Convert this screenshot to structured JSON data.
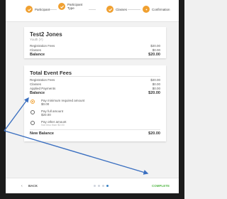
{
  "stepper": {
    "steps": [
      {
        "label": "Participant"
      },
      {
        "label": "Participant Type"
      },
      {
        "label": "Classes"
      },
      {
        "label": "Confirmation"
      }
    ]
  },
  "participant_card": {
    "name": "Test2 Jones",
    "subtitle": "Youth (Y)",
    "rows": [
      {
        "label": "Registration Fees",
        "value": "$20.00"
      },
      {
        "label": "Classes",
        "value": "$0.00"
      }
    ],
    "balance_label": "Balance",
    "balance_value": "$20.00"
  },
  "event_fees_card": {
    "title": "Total Event Fees",
    "rows": [
      {
        "label": "Registration Fees",
        "value": "$20.00"
      },
      {
        "label": "Classes",
        "value": "$0.00"
      },
      {
        "label": "Applied Payments",
        "value": "$0.00"
      }
    ],
    "balance_label": "Balance",
    "balance_value": "$20.00",
    "options": [
      {
        "label": "Pay minimum required amount",
        "amount": "$0.00",
        "selected": true
      },
      {
        "label": "Pay full amount",
        "amount": "$20.00",
        "selected": false
      },
      {
        "label": "Pay other amount",
        "note": "Not less than $0.00",
        "selected": false
      }
    ],
    "new_balance_label": "New Balance",
    "new_balance_value": "$20.00"
  },
  "footer": {
    "back_label": "BACK",
    "complete_label": "COMPLETE",
    "page_dots": 4,
    "active_dot": 4
  },
  "colors": {
    "accent": "#f0a030",
    "complete": "#57b94a",
    "annotation_arrow": "#3a6fc0"
  },
  "icons": {
    "step_done": "check-icon"
  }
}
